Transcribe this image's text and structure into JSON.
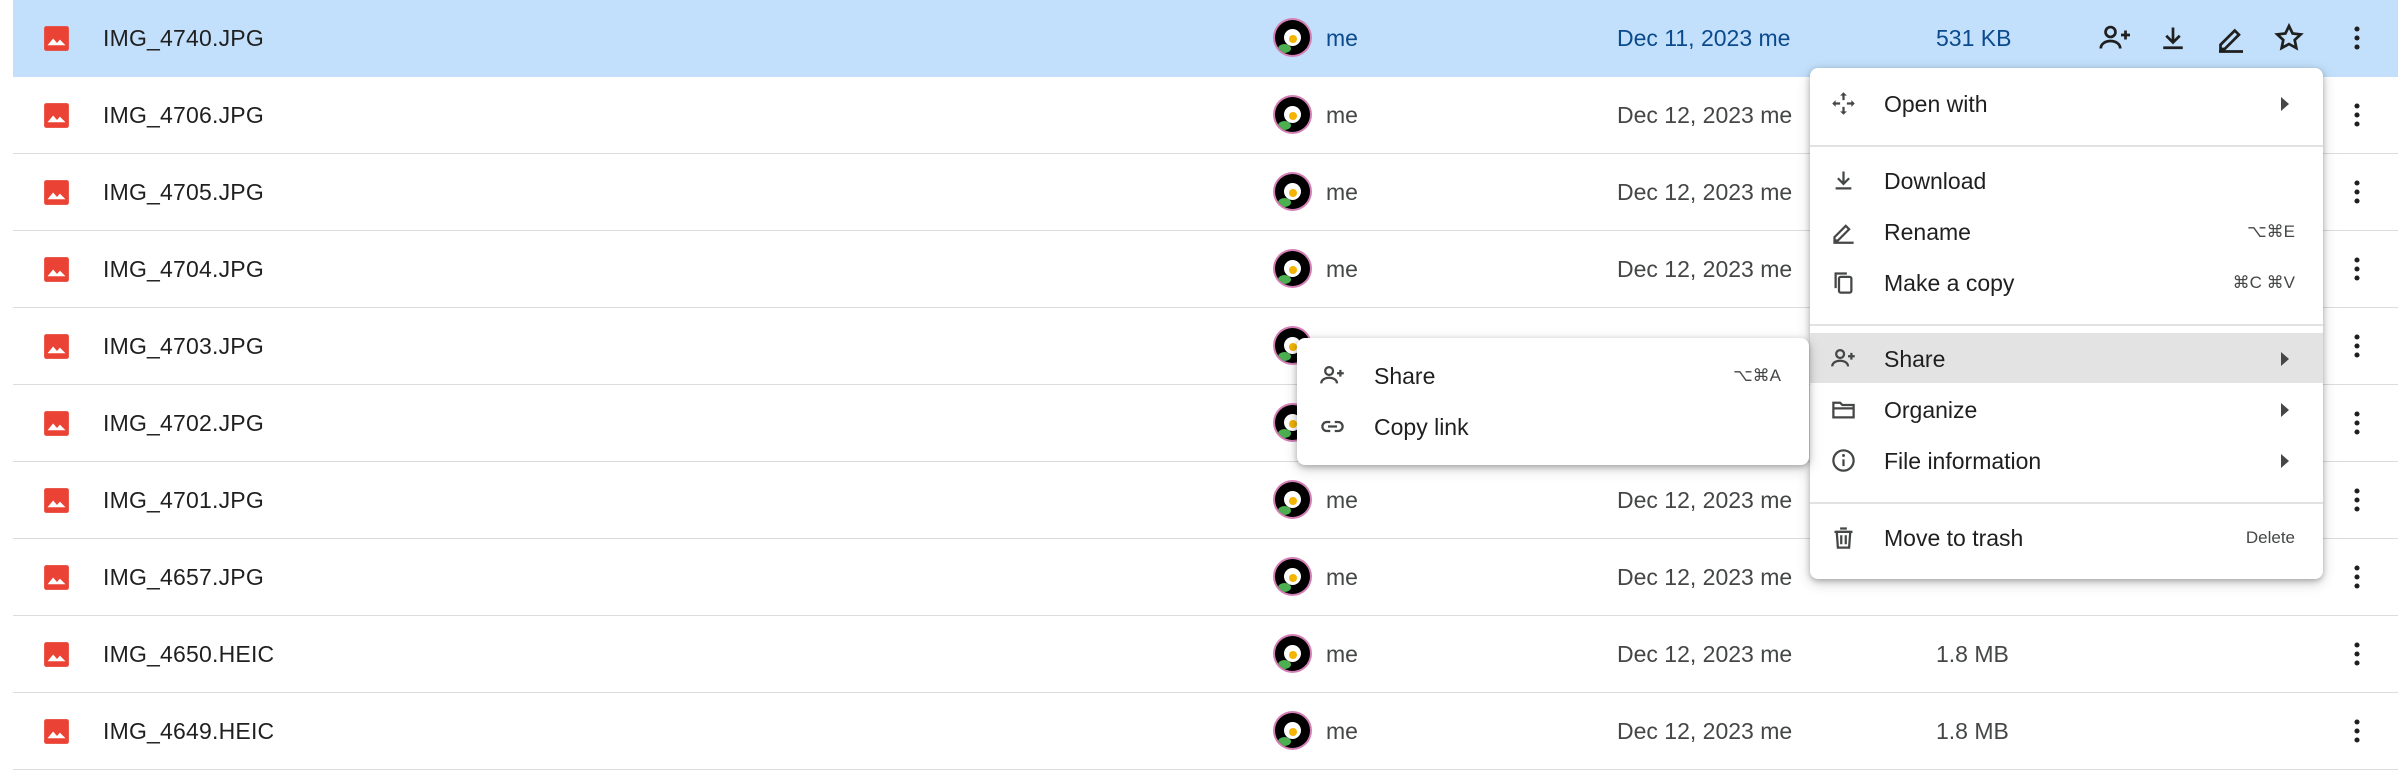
{
  "files": [
    {
      "name": "IMG_4740.JPG",
      "owner": "me",
      "modified": "Dec 11, 2023",
      "modified_by": "me",
      "size": "531 KB",
      "selected": true
    },
    {
      "name": "IMG_4706.JPG",
      "owner": "me",
      "modified": "Dec 12, 2023",
      "modified_by": "me",
      "size": ""
    },
    {
      "name": "IMG_4705.JPG",
      "owner": "me",
      "modified": "Dec 12, 2023",
      "modified_by": "me",
      "size": ""
    },
    {
      "name": "IMG_4704.JPG",
      "owner": "me",
      "modified": "Dec 12, 2023",
      "modified_by": "me",
      "size": ""
    },
    {
      "name": "IMG_4703.JPG",
      "owner": "",
      "modified": "",
      "modified_by": "",
      "size": ""
    },
    {
      "name": "IMG_4702.JPG",
      "owner": "",
      "modified": "",
      "modified_by": "",
      "size": ""
    },
    {
      "name": "IMG_4701.JPG",
      "owner": "me",
      "modified": "Dec 12, 2023",
      "modified_by": "me",
      "size": ""
    },
    {
      "name": "IMG_4657.JPG",
      "owner": "me",
      "modified": "Dec 12, 2023",
      "modified_by": "me",
      "size": ""
    },
    {
      "name": "IMG_4650.HEIC",
      "owner": "me",
      "modified": "Dec 12, 2023",
      "modified_by": "me",
      "size": "1.8 MB"
    },
    {
      "name": "IMG_4649.HEIC",
      "owner": "me",
      "modified": "Dec 12, 2023",
      "modified_by": "me",
      "size": "1.8 MB"
    }
  ],
  "row_actions": [
    "add-person-icon",
    "download-icon",
    "edit-icon",
    "star-icon"
  ],
  "context_menu": {
    "open_with": "Open with",
    "download": "Download",
    "rename": "Rename",
    "rename_shortcut": "⌥⌘E",
    "make_copy": "Make a copy",
    "make_copy_shortcut": "⌘C ⌘V",
    "share": "Share",
    "organize": "Organize",
    "file_information": "File information",
    "move_to_trash": "Move to trash",
    "move_to_trash_shortcut": "Delete"
  },
  "share_submenu": {
    "share": "Share",
    "share_shortcut": "⌥⌘A",
    "copy_link": "Copy link"
  },
  "colors": {
    "selected_row": "#c2e0fb",
    "image_icon": "#ea4335",
    "highlight": "#e3e3e3"
  }
}
